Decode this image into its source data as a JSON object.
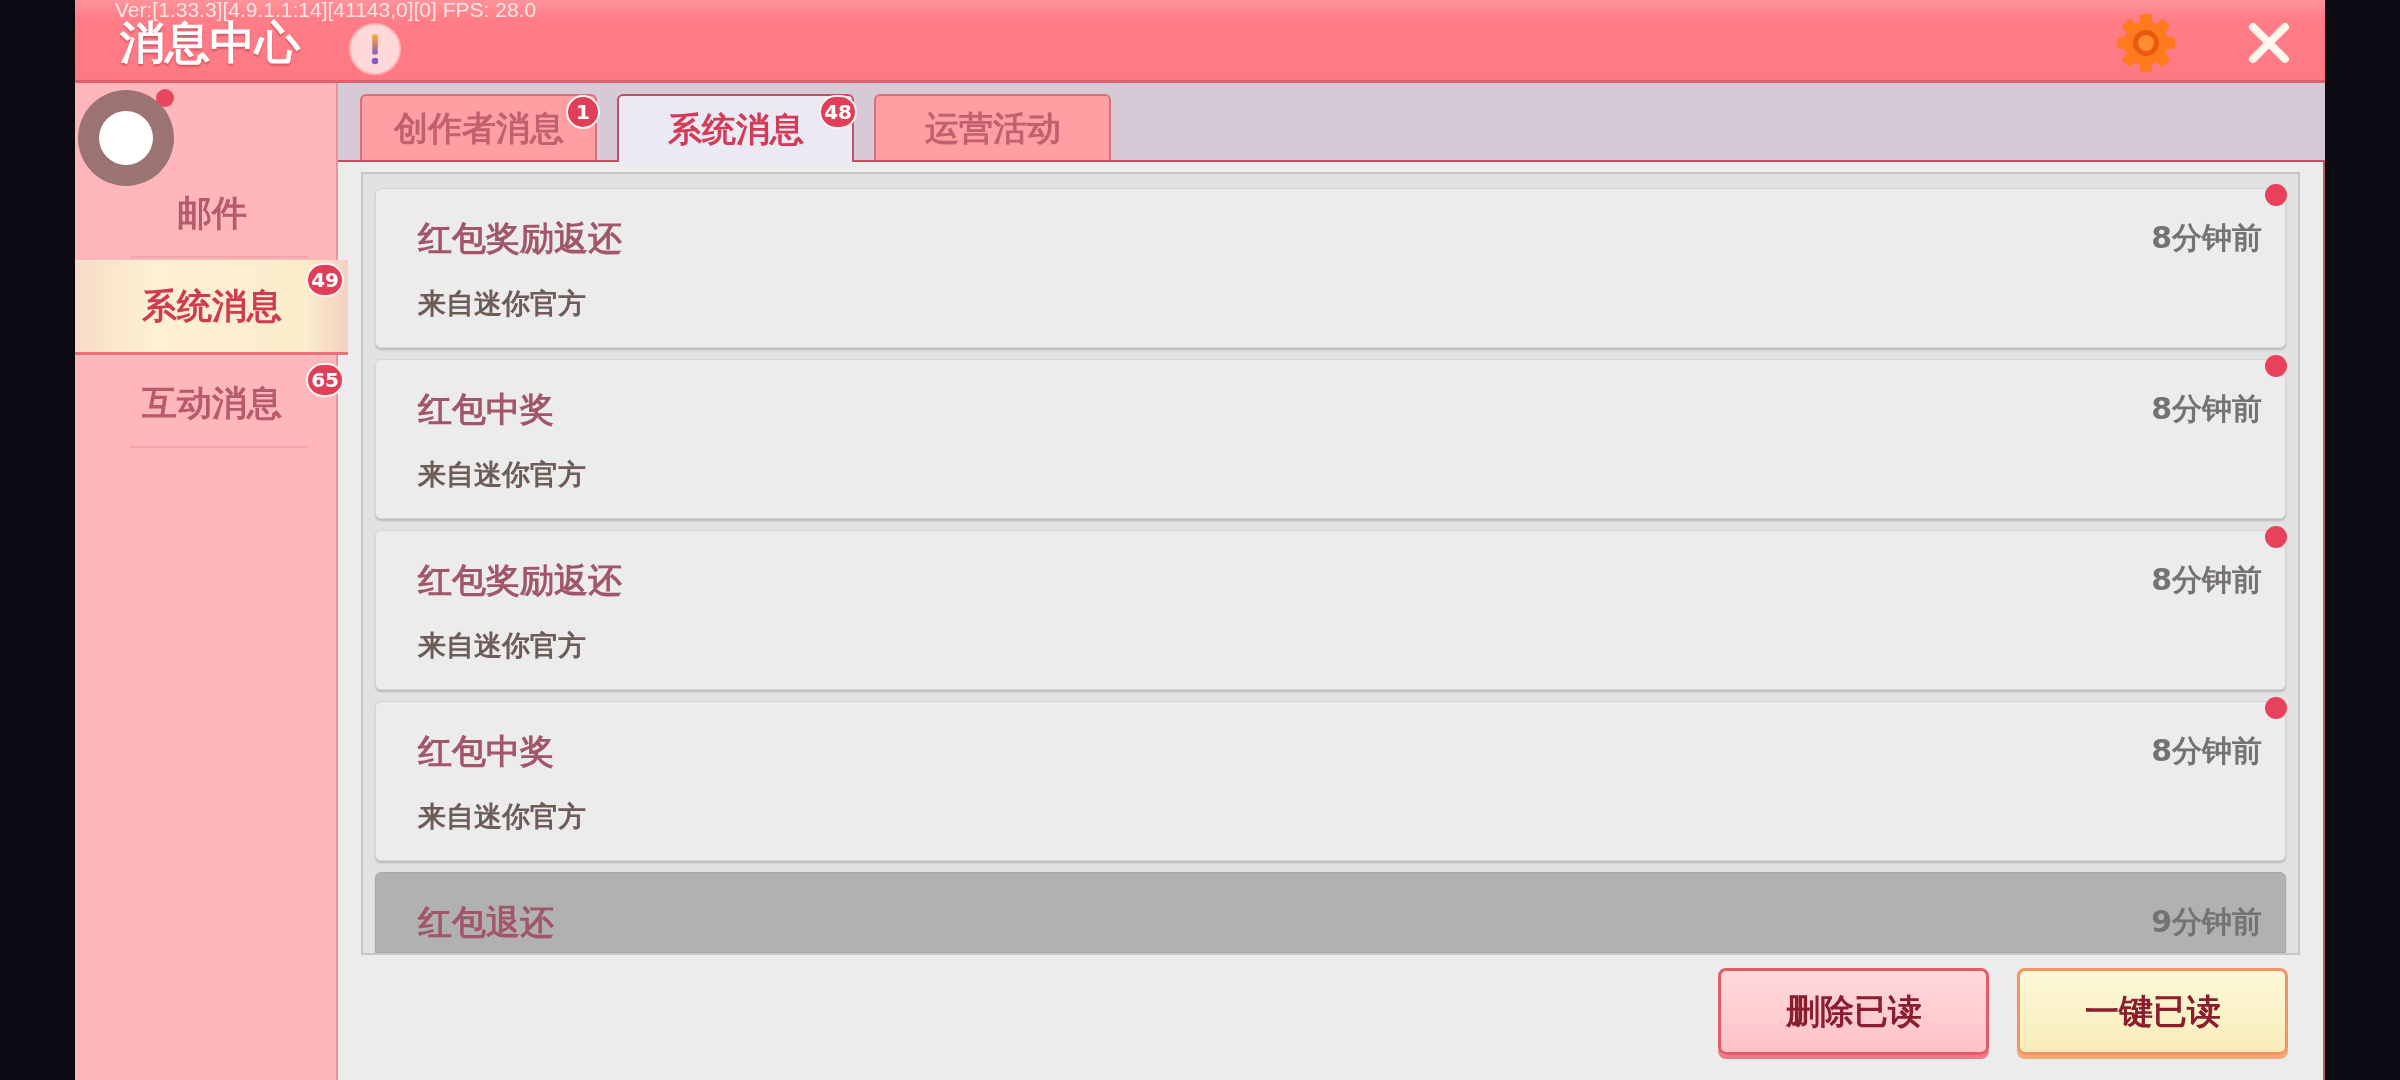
{
  "debug_overlay": "Ver:[1.33.3][4.9.1.1:14][41143,0][0] FPS: 28.0",
  "header": {
    "title": "消息中心"
  },
  "sidebar": {
    "avatar": {
      "notification_dot": true
    },
    "items": [
      {
        "label": "邮件",
        "selected": false
      },
      {
        "label": "系统消息",
        "selected": true,
        "badge": "49"
      },
      {
        "label": "互动消息",
        "selected": false,
        "badge": "65"
      }
    ]
  },
  "tabs": [
    {
      "label": "创作者消息",
      "selected": false,
      "badge": "1"
    },
    {
      "label": "系统消息",
      "selected": true,
      "badge": "48"
    },
    {
      "label": "运营活动",
      "selected": false
    }
  ],
  "messages": [
    {
      "title": "红包奖励返还",
      "source": "来自迷你官方",
      "time": "8分钟前",
      "unread": true,
      "selected": false
    },
    {
      "title": "红包中奖",
      "source": "来自迷你官方",
      "time": "8分钟前",
      "unread": true,
      "selected": false
    },
    {
      "title": "红包奖励返还",
      "source": "来自迷你官方",
      "time": "8分钟前",
      "unread": true,
      "selected": false
    },
    {
      "title": "红包中奖",
      "source": "来自迷你官方",
      "time": "8分钟前",
      "unread": true,
      "selected": false
    },
    {
      "title": "红包退还",
      "time": "9分钟前",
      "unread": false,
      "selected": true
    }
  ],
  "buttons": [
    {
      "label": "删除已读",
      "kind": "delete"
    },
    {
      "label": "一键已读",
      "kind": "read-all"
    }
  ]
}
